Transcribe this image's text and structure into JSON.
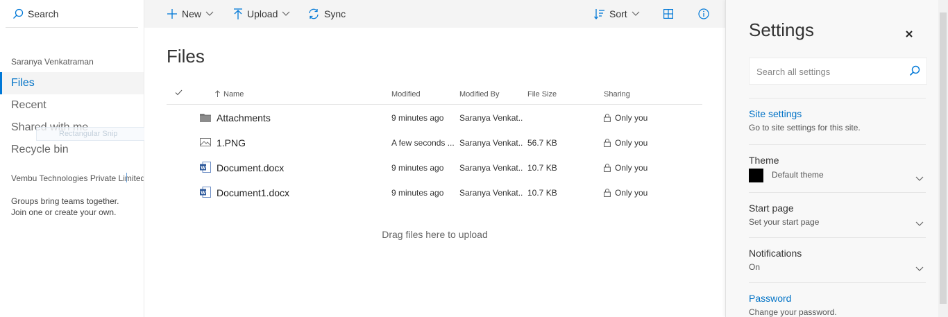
{
  "leftnav": {
    "search_label": "Search",
    "user": "Saranya Venkatraman",
    "items": [
      {
        "label": "Files"
      },
      {
        "label": "Recent"
      },
      {
        "label": "Shared with me"
      },
      {
        "label": "Recycle bin"
      }
    ],
    "snip_overlay": "Rectangular Snip",
    "org": "Vembu Technologies Private Limited",
    "groups_text": "Groups bring teams together. Join one or create your own."
  },
  "toolbar": {
    "new_label": "New",
    "upload_label": "Upload",
    "sync_label": "Sync",
    "sort_label": "Sort"
  },
  "main": {
    "title": "Files",
    "columns": {
      "name": "Name",
      "modified": "Modified",
      "modified_by": "Modified By",
      "file_size": "File Size",
      "sharing": "Sharing"
    },
    "files": [
      {
        "icon": "folder-icon",
        "name": "Attachments",
        "modified": "9 minutes ago",
        "modified_by": "Saranya Venkat...",
        "size": "",
        "sharing": "Only you"
      },
      {
        "icon": "image-file-icon",
        "name": "1.PNG",
        "modified": "A few seconds ...",
        "modified_by": "Saranya Venkat...",
        "size": "56.7 KB",
        "sharing": "Only you"
      },
      {
        "icon": "word-doc-icon",
        "name": "Document.docx",
        "modified": "9 minutes ago",
        "modified_by": "Saranya Venkat...",
        "size": "10.7 KB",
        "sharing": "Only you"
      },
      {
        "icon": "word-doc-icon",
        "name": "Document1.docx",
        "modified": "9 minutes ago",
        "modified_by": "Saranya Venkat...",
        "size": "10.7 KB",
        "sharing": "Only you"
      }
    ],
    "drag_hint": "Drag files here to upload"
  },
  "settings": {
    "title": "Settings",
    "search_placeholder": "Search all settings",
    "site_settings": {
      "label": "Site settings",
      "desc": "Go to site settings for this site."
    },
    "theme": {
      "label": "Theme",
      "value": "Default theme",
      "swatch_color": "#000000"
    },
    "start_page": {
      "label": "Start page",
      "value": "Set your start page"
    },
    "notifications": {
      "label": "Notifications",
      "value": "On"
    },
    "password": {
      "label": "Password",
      "desc": "Change your password."
    }
  },
  "colors": {
    "accent": "#0078d7",
    "link": "#0072c6"
  }
}
